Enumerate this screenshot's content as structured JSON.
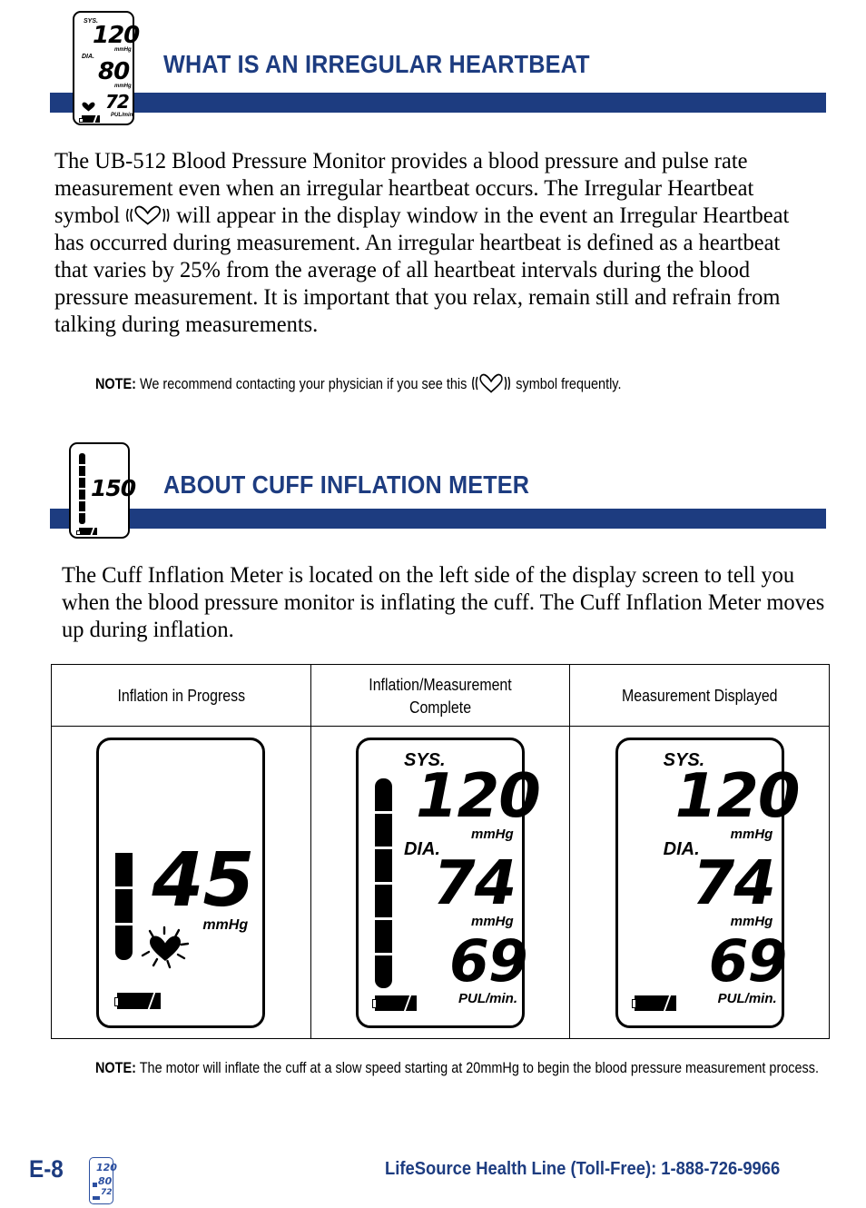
{
  "page": {
    "accent_color": "#1d3c80",
    "page_number": "E-8"
  },
  "section1": {
    "title": "WHAT IS AN IRREGULAR HEARTBEAT",
    "icon": {
      "name": "bp-monitor-display",
      "sys_label": "SYS.",
      "sys_value": "120",
      "sys_unit": "mmHg",
      "dia_label": "DIA.",
      "dia_value": "80",
      "dia_unit": "mmHg",
      "pulse_value": "72",
      "pulse_unit": "PUL/min.",
      "heart_symbol": "♥"
    },
    "paragraph": "The UB-512 Blood Pressure Monitor provides a blood pressure and pulse rate measurement even when an irregular heartbeat occurs. The Irregular Heartbeat symbol ",
    "paragraph_2": " will appear in the display window in the event an Irregular Heartbeat has occurred during measurement. An irregular heartbeat is defined as a heartbeat that varies by 25% from the average of all heartbeat intervals during the blood pressure measurement. It is important that you relax, remain still and refrain from talking during measurements.",
    "note_label": "NOTE:",
    "note_text_1": "We recommend contacting your physician if you see this",
    "note_text_2": "symbol frequently."
  },
  "section2": {
    "title": "ABOUT CUFF INFLATION METER",
    "icon": {
      "name": "cuff-inflation-meter-display",
      "value": "150"
    },
    "paragraph": "The Cuff Inflation Meter is located on the left side of the display screen to tell you when the blood pressure monitor is inflating the cuff. The Cuff Inflation Meter moves up during inflation.",
    "note_label": "NOTE:",
    "note_text": "The motor will inflate the cuff at a slow speed starting at 20mmHg to begin the blood pressure measurement process."
  },
  "table": {
    "headers": [
      "Inflation in Progress",
      "Inflation/Measurement Complete",
      "Measurement Displayed"
    ],
    "cells": [
      {
        "state": "inflation-in-progress",
        "bars_filled": 3,
        "bars_total": 6,
        "pressure_value": "45",
        "pressure_unit": "mmHg",
        "heartbeat_flashing": true,
        "battery": true
      },
      {
        "state": "inflation-measurement-complete",
        "bars_filled": 6,
        "bars_total": 6,
        "sys_label": "SYS.",
        "sys_value": "120",
        "sys_unit": "mmHg",
        "dia_label": "DIA.",
        "dia_value": "74",
        "dia_unit": "mmHg",
        "pulse_value": "69",
        "pulse_unit": "PUL/min.",
        "battery": true
      },
      {
        "state": "measurement-displayed",
        "bars_filled": 0,
        "bars_total": 6,
        "sys_label": "SYS.",
        "sys_value": "120",
        "sys_unit": "mmHg",
        "dia_label": "DIA.",
        "dia_value": "74",
        "dia_unit": "mmHg",
        "pulse_value": "69",
        "pulse_unit": "PUL/min.",
        "battery": true
      }
    ]
  },
  "footer": {
    "page_label": "E-8",
    "health_line": "LifeSource Health Line (Toll-Free): 1-888-726-9966",
    "icon": {
      "sys_value": "120",
      "dia_value": "80",
      "pulse_value": "72"
    }
  }
}
